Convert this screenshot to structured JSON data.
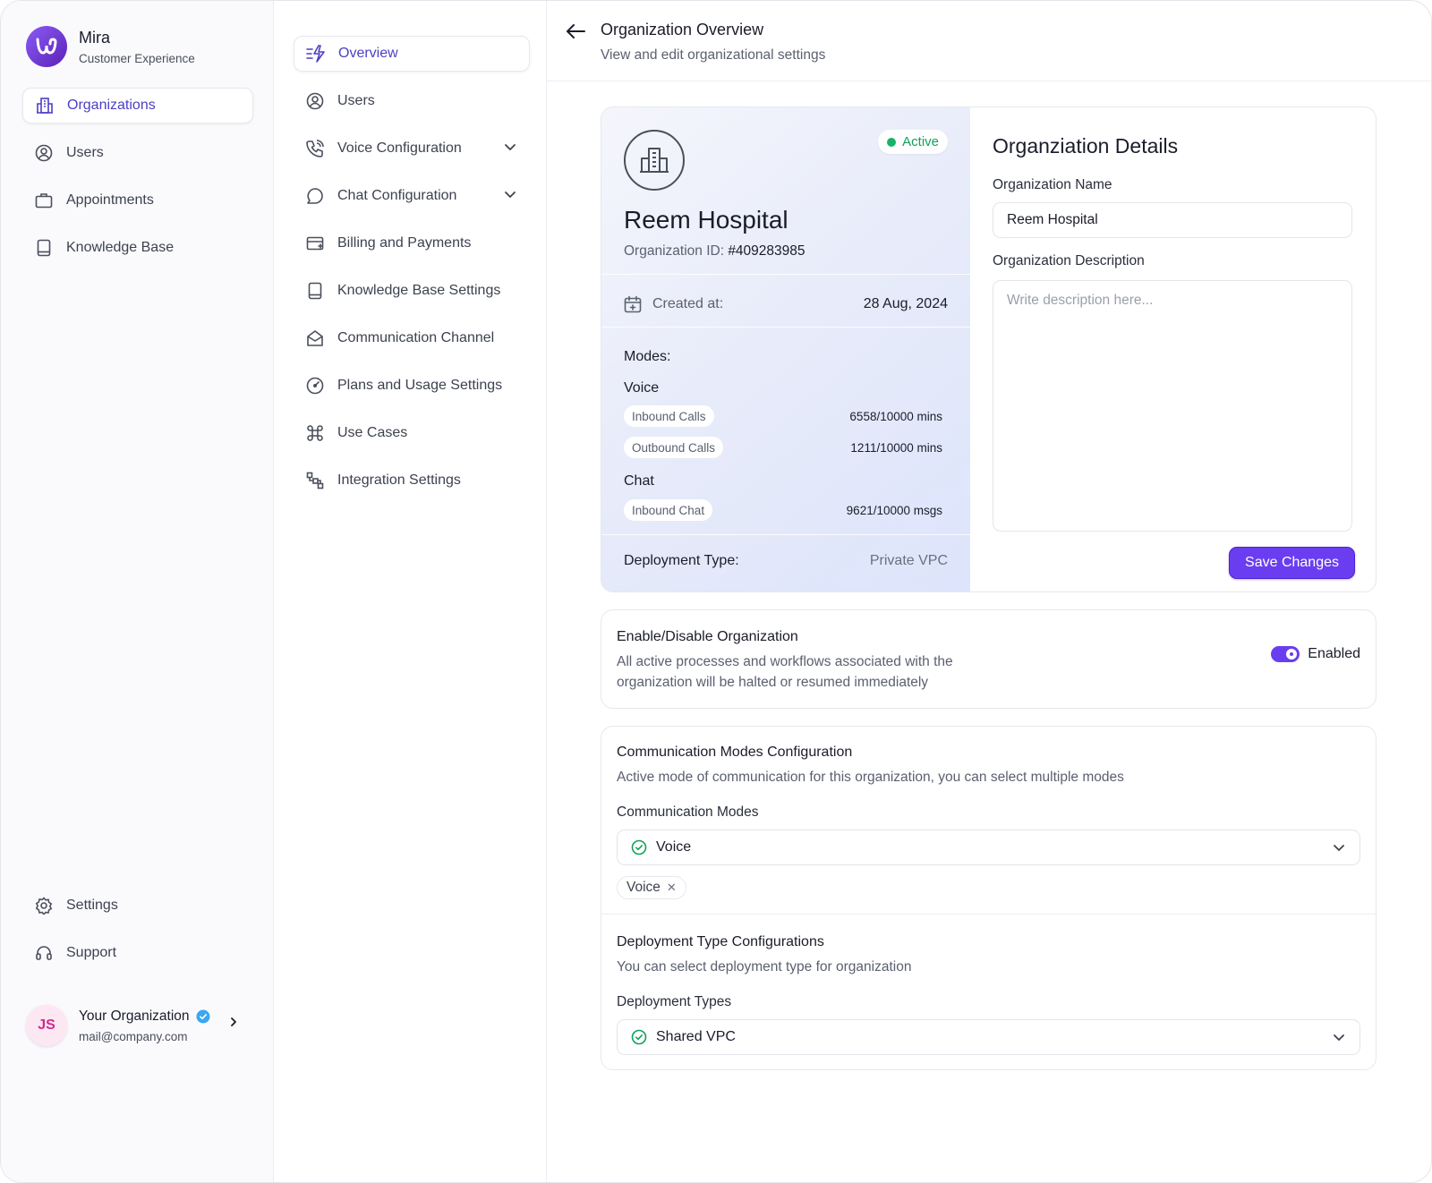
{
  "brand": {
    "name": "Mira",
    "subtitle": "Customer Experience"
  },
  "sidebar": {
    "items": [
      {
        "label": "Organizations",
        "icon": "building-icon",
        "active": true
      },
      {
        "label": "Users",
        "icon": "user-circle-icon"
      },
      {
        "label": "Appointments",
        "icon": "briefcase-icon"
      },
      {
        "label": "Knowledge Base",
        "icon": "book-icon"
      }
    ],
    "bottom_items": [
      {
        "label": "Settings",
        "icon": "gear-icon"
      },
      {
        "label": "Support",
        "icon": "headset-icon"
      }
    ],
    "profile": {
      "initials": "JS",
      "name": "Your Organization",
      "email": "mail@company.com"
    }
  },
  "subnav": {
    "items": [
      {
        "label": "Overview",
        "icon": "overview-icon",
        "active": true
      },
      {
        "label": "Users",
        "icon": "user-circle-icon"
      },
      {
        "label": "Voice Configuration",
        "icon": "phone-icon",
        "expandable": true
      },
      {
        "label": "Chat Configuration",
        "icon": "chat-icon",
        "expandable": true
      },
      {
        "label": "Billing and Payments",
        "icon": "card-icon"
      },
      {
        "label": "Knowledge Base Settings",
        "icon": "book-icon"
      },
      {
        "label": "Communication Channel",
        "icon": "envelope-icon"
      },
      {
        "label": "Plans and Usage Settings",
        "icon": "gauge-icon"
      },
      {
        "label": "Use Cases",
        "icon": "command-icon"
      },
      {
        "label": "Integration Settings",
        "icon": "integration-icon"
      }
    ]
  },
  "header": {
    "title": "Organization Overview",
    "subtitle": "View and edit organizational settings"
  },
  "org": {
    "status": "Active",
    "name": "Reem Hospital",
    "id_label": "Organization ID:",
    "id_value": "#409283985",
    "created_label": "Created at:",
    "created_value": "28 Aug, 2024",
    "modes_label": "Modes:",
    "voice_label": "Voice",
    "chat_label": "Chat",
    "usage": [
      {
        "label": "Inbound Calls",
        "value": "6558/10000 mins"
      },
      {
        "label": "Outbound Calls",
        "value": "1211/10000 mins"
      },
      {
        "label": "Inbound Chat",
        "value": "9621/10000 msgs"
      }
    ],
    "deployment_label": "Deployment Type:",
    "deployment_value": "Private VPC"
  },
  "details": {
    "title": "Organziation Details",
    "name_label": "Organization Name",
    "name_value": "Reem Hospital",
    "desc_label": "Organization Description",
    "desc_placeholder": "Write description here...",
    "save_label": "Save Changes"
  },
  "enable_card": {
    "title": "Enable/Disable Organization",
    "desc_line1": "All active processes and workflows associated with the",
    "desc_line2": "organization will be halted or resumed immediately",
    "toggle_label": "Enabled",
    "enabled": true
  },
  "comm_card": {
    "title": "Communication Modes Configuration",
    "desc": "Active mode of communication for this organization, you can select multiple modes",
    "field_label": "Communication Modes",
    "selected": "Voice",
    "tag": "Voice"
  },
  "deploy_card": {
    "title": "Deployment Type Configurations",
    "desc": "You can select deployment type for organization",
    "field_label": "Deployment Types",
    "selected": "Shared VPC"
  },
  "colors": {
    "accent": "#6a3ef0",
    "active_green": "#16b364",
    "nav_active_text": "#4b3fc4"
  }
}
